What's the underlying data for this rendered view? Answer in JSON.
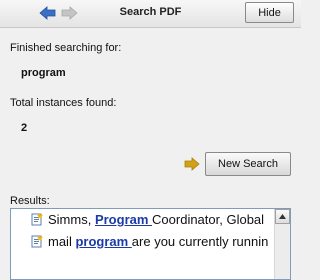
{
  "header": {
    "title": "Search PDF",
    "hide_label": "Hide",
    "back_icon": "back-arrow-icon",
    "forward_icon": "forward-arrow-icon"
  },
  "search": {
    "searching_label": "Finished searching for:",
    "term": "program",
    "total_label": "Total instances found:",
    "count": "2",
    "new_search_label": "New Search"
  },
  "results": {
    "label": "Results:",
    "items": [
      {
        "before": "Simms, ",
        "match": "Program ",
        "after": "Coordinator, Global"
      },
      {
        "before": "mail ",
        "match": "program ",
        "after": "are you currently runnin"
      }
    ]
  },
  "colors": {
    "back_arrow": "#3a6fc4",
    "forward_arrow": "#b9b9b9",
    "new_search_arrow": "#d4a017",
    "match_text": "#1a3aa8"
  }
}
